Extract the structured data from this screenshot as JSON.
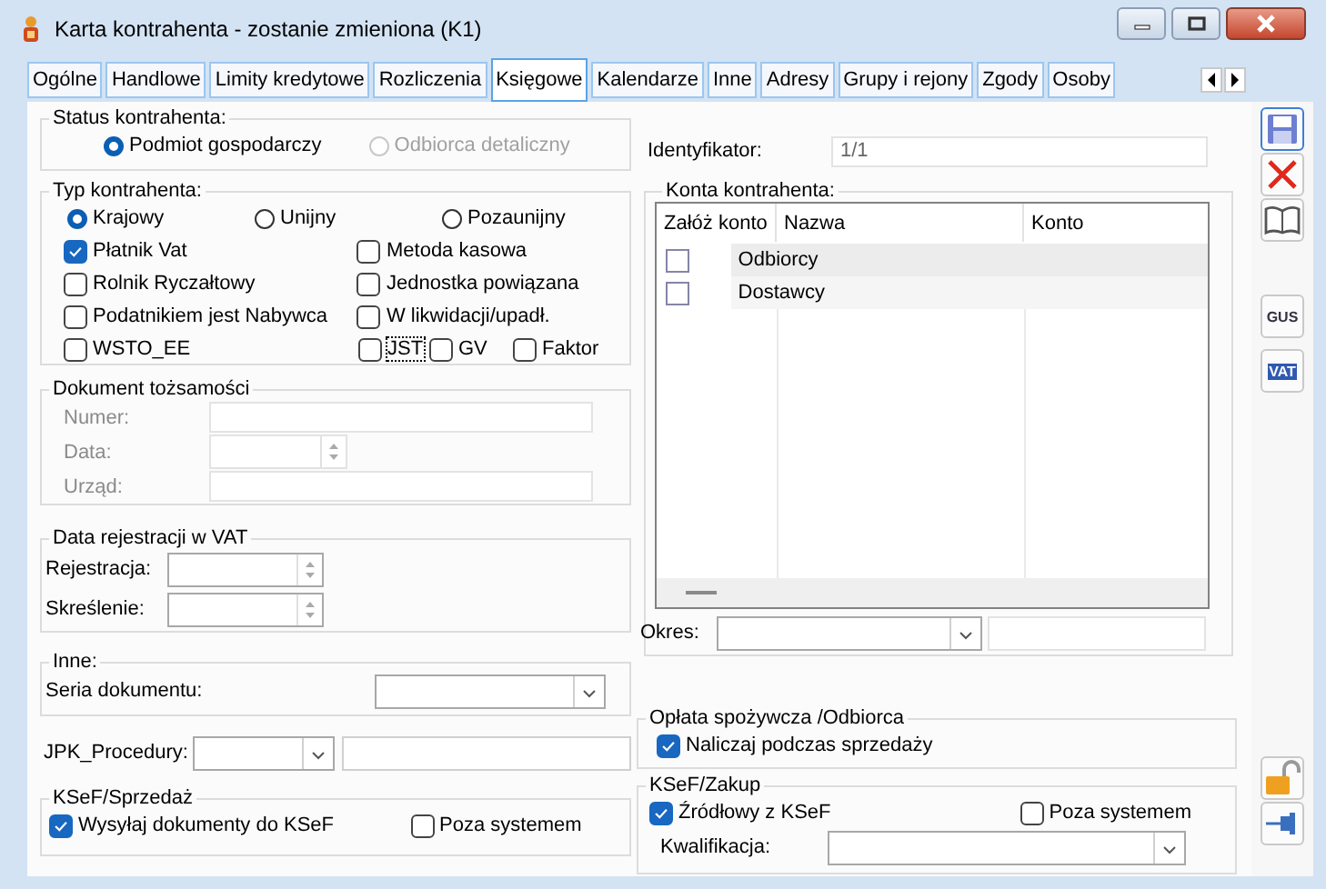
{
  "window": {
    "title": "Karta kontrahenta - zostanie zmieniona (K1)"
  },
  "tabs": [
    {
      "label": "Ogólne",
      "selected": false
    },
    {
      "label": "Handlowe",
      "selected": false
    },
    {
      "label": "Limity kredytowe",
      "selected": false
    },
    {
      "label": "Rozliczenia",
      "selected": false
    },
    {
      "label": "Księgowe",
      "selected": true
    },
    {
      "label": "Kalendarze",
      "selected": false
    },
    {
      "label": "Inne",
      "selected": false
    },
    {
      "label": "Adresy",
      "selected": false
    },
    {
      "label": "Grupy i rejony",
      "selected": false
    },
    {
      "label": "Zgody",
      "selected": false
    },
    {
      "label": "Osoby",
      "selected": false
    }
  ],
  "status_kontrahenta": {
    "title": "Status kontrahenta:",
    "options": [
      {
        "label": "Podmiot gospodarczy",
        "selected": true,
        "disabled": false
      },
      {
        "label": "Odbiorca detaliczny",
        "selected": false,
        "disabled": true
      }
    ]
  },
  "typ_kontrahenta": {
    "title": "Typ kontrahenta:",
    "options": [
      {
        "label": "Krajowy",
        "selected": true
      },
      {
        "label": "Unijny",
        "selected": false
      },
      {
        "label": "Pozaunijny",
        "selected": false
      }
    ],
    "rows": [
      [
        {
          "label": "Płatnik Vat",
          "checked": true,
          "focused": false
        },
        {
          "label": "Metoda kasowa",
          "checked": false,
          "focused": false
        }
      ],
      [
        {
          "label": "Rolnik Ryczałtowy",
          "checked": false,
          "focused": false
        },
        {
          "label": "Jednostka powiązana",
          "checked": false,
          "focused": false
        }
      ],
      [
        {
          "label": "Podatnikiem jest Nabywca",
          "checked": false,
          "focused": false
        },
        {
          "label": "W likwidacji/upadł.",
          "checked": false,
          "focused": false
        }
      ],
      [
        {
          "label": "WSTO_EE",
          "checked": false,
          "focused": false
        },
        {
          "label": "JST",
          "checked": false,
          "focused": true
        },
        {
          "label": "GV",
          "checked": false,
          "focused": false
        },
        {
          "label": "Faktor",
          "checked": false,
          "focused": false
        }
      ]
    ]
  },
  "dokument_tozsamosci": {
    "title": "Dokument tożsamości",
    "fields": [
      {
        "label": "Numer:",
        "kind": "text",
        "disabled": true
      },
      {
        "label": "Data:",
        "kind": "date",
        "disabled": true
      },
      {
        "label": "Urząd:",
        "kind": "text",
        "disabled": true
      }
    ]
  },
  "data_rejestracji_vat": {
    "title": "Data rejestracji w VAT",
    "fields": [
      {
        "label": "Rejestracja:",
        "kind": "date",
        "disabled": false
      },
      {
        "label": "Skreślenie:",
        "kind": "date",
        "disabled": false
      }
    ]
  },
  "inne": {
    "title": "Inne:",
    "seria_dokumentu": {
      "label": "Seria dokumentu:"
    }
  },
  "jpk_procedury": {
    "label": "JPK_Procedury:"
  },
  "ksef_sprzedaz": {
    "title": "KSeF/Sprzedaż",
    "checkboxes": [
      {
        "label": "Wysyłaj dokumenty do KSeF",
        "checked": true
      },
      {
        "label": "Poza systemem",
        "checked": false
      }
    ]
  },
  "identyfikator": {
    "label": "Identyfikator:",
    "value": "1/1"
  },
  "konta_kontrahenta": {
    "title": "Konta kontrahenta:",
    "columns": [
      "Załóż konto",
      "Nazwa",
      "Konto"
    ],
    "rows": [
      {
        "checked": false,
        "nazwa": "Odbiorcy"
      },
      {
        "checked": false,
        "nazwa": "Dostawcy"
      }
    ],
    "okres": {
      "label": "Okres:"
    }
  },
  "oplata_spozywcza": {
    "title": "Opłata spożywcza /Odbiorca",
    "checkboxes": [
      {
        "label": "Naliczaj podczas sprzedaży",
        "checked": true
      }
    ]
  },
  "ksef_zakup": {
    "title": "KSeF/Zakup",
    "checkboxes": [
      {
        "label": "Źródłowy z KSeF",
        "checked": true
      },
      {
        "label": "Poza systemem",
        "checked": false
      }
    ],
    "kwalifikacja": {
      "label": "Kwalifikacja:"
    }
  },
  "toolbar": [
    {
      "kind": "save"
    },
    {
      "kind": "cancel"
    },
    {
      "kind": "book"
    },
    {
      "kind": "gus",
      "label": "GUS"
    },
    {
      "kind": "vat",
      "label": "VAT"
    },
    {
      "kind": "lock"
    },
    {
      "kind": "pin"
    }
  ]
}
